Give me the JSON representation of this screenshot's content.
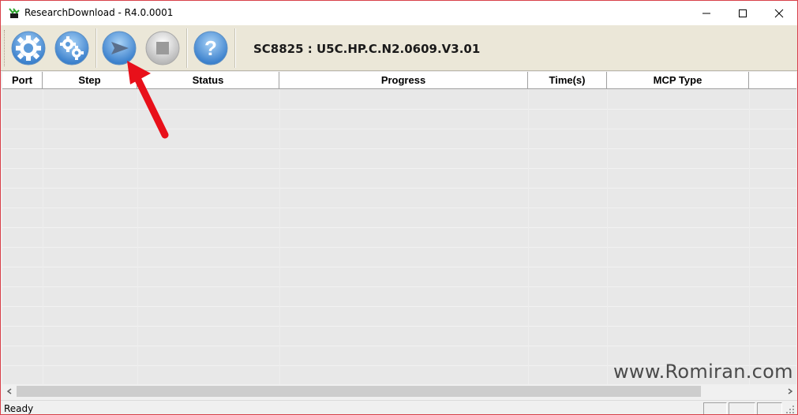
{
  "window": {
    "title": "ResearchDownload - R4.0.0001",
    "accent_color": "#d8414a"
  },
  "toolbar": {
    "buttons": [
      {
        "name": "settings",
        "icon": "gear-icon"
      },
      {
        "name": "load-packet",
        "icon": "gears-icon"
      },
      {
        "name": "start-download",
        "icon": "play-arrow-icon"
      },
      {
        "name": "stop-download",
        "icon": "stop-icon"
      },
      {
        "name": "help",
        "icon": "question-icon"
      }
    ],
    "version_label": "SC8825 : U5C.HP.C.N2.0609.V3.01"
  },
  "table": {
    "columns": [
      "Port",
      "Step",
      "Status",
      "Progress",
      "Time(s)",
      "MCP Type"
    ],
    "rows": []
  },
  "statusbar": {
    "text": "Ready"
  },
  "watermark": "www.Romiran.com",
  "colors": {
    "toolbar_bg": "#ebe7d8",
    "button_blue": "#4d8fd4",
    "annotation_arrow": "#e8101a"
  }
}
